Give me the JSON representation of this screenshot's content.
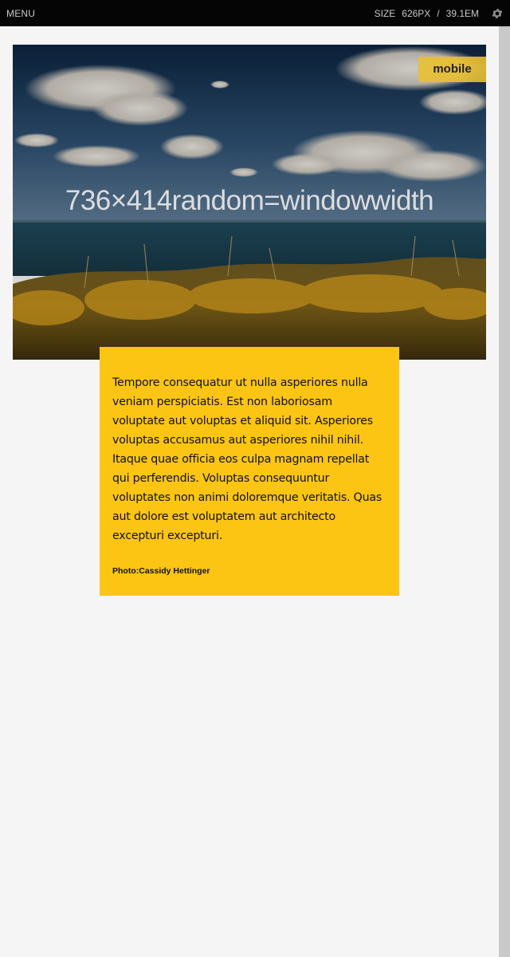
{
  "topbar": {
    "menu_label": "MENU",
    "size_label": "SIZE",
    "size_px": "626PX",
    "separator": "/",
    "size_em": "39.1EM",
    "settings_icon": "gear-icon"
  },
  "hero": {
    "caption": "736×414random=windowwidth",
    "badge": "mobile"
  },
  "card": {
    "body": "Tempore consequatur ut nulla asperiores nulla veniam perspiciatis. Est non laboriosam voluptate aut voluptas et aliquid sit. Asperiores voluptas accusamus aut asperiores nihil nihil. Itaque quae officia eos culpa magnam repellat qui perferendis. Voluptas consequuntur voluptates non animi doloremque veritatis. Quas aut dolore est voluptatem aut architecto excepturi excepturi.",
    "credit": "Photo:Cassidy Hettinger"
  },
  "colors": {
    "topbar_bg": "#050505",
    "card_bg": "#fcc514",
    "badge_bg": "#e8c034",
    "page_bg": "#f5f5f5"
  }
}
